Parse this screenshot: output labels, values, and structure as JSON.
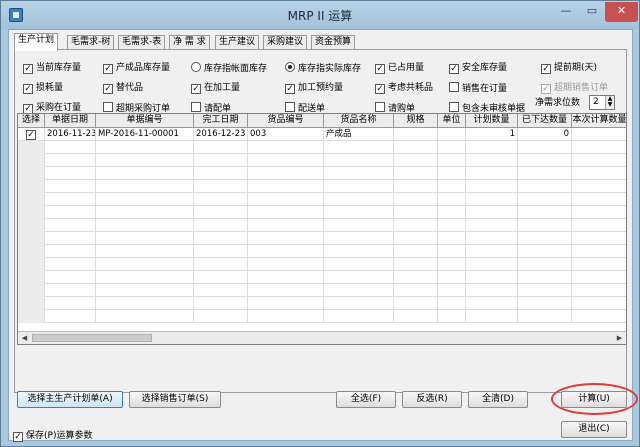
{
  "window": {
    "title": "MRP II 运算",
    "minimize": "—",
    "maximize": "▭",
    "close": "✕"
  },
  "tabs": [
    {
      "label": "生产计划",
      "active": true
    },
    {
      "label": "毛需求-树",
      "active": false
    },
    {
      "label": "毛需求-表",
      "active": false
    },
    {
      "label": "净 需 求",
      "active": false
    },
    {
      "label": "生产建议",
      "active": false
    },
    {
      "label": "采购建议",
      "active": false
    },
    {
      "label": "资金预算",
      "active": false
    }
  ],
  "options": {
    "row1": [
      {
        "label": "当前库存量",
        "type": "checkbox",
        "checked": true
      },
      {
        "label": "产成品库存量",
        "type": "checkbox",
        "checked": true
      },
      {
        "label": "库存指帐面库存",
        "type": "radio",
        "checked": false
      },
      {
        "label": "库存指实际库存",
        "type": "radio",
        "checked": true
      },
      {
        "label": "已占用量",
        "type": "checkbox",
        "checked": true
      },
      {
        "label": "安全库存量",
        "type": "checkbox",
        "checked": true
      },
      {
        "label": "提前期(天)",
        "type": "checkbox",
        "checked": true
      }
    ],
    "row2": [
      {
        "label": "损耗量",
        "type": "checkbox",
        "checked": true
      },
      {
        "label": "替代品",
        "type": "checkbox",
        "checked": true
      },
      {
        "label": "在加工量",
        "type": "checkbox",
        "checked": true
      },
      {
        "label": "加工预约量",
        "type": "checkbox",
        "checked": true
      },
      {
        "label": "考虑共耗品",
        "type": "checkbox",
        "checked": true
      },
      {
        "label": "销售在订量",
        "type": "checkbox",
        "checked": false
      },
      {
        "label": "超期销售订单",
        "type": "checkbox",
        "checked": true,
        "disabled": true
      }
    ],
    "row3": [
      {
        "label": "采购在订量",
        "type": "checkbox",
        "checked": true
      },
      {
        "label": "超期采购订单",
        "type": "checkbox",
        "checked": false
      },
      {
        "label": "请配单",
        "type": "checkbox",
        "checked": false
      },
      {
        "label": "配送单",
        "type": "checkbox",
        "checked": false
      },
      {
        "label": "请购单",
        "type": "checkbox",
        "checked": false
      },
      {
        "label": "包含未审核单据",
        "type": "checkbox",
        "checked": false
      }
    ],
    "precision_label": "净需求位数",
    "precision_value": "2",
    "spin_up": "▲",
    "spin_down": "▼",
    "check_mark": "✓"
  },
  "grid": {
    "columns": [
      "选择",
      "单据日期",
      "单据编号",
      "完工日期",
      "货品编号",
      "货品名称",
      "规格",
      "单位",
      "计划数量",
      "已下达数量",
      "本次计算数量"
    ],
    "rows": [
      {
        "selected": true,
        "doc_date": "2016-11-23",
        "doc_no": "MP-2016-11-00001",
        "finish_date": "2016-12-23",
        "item_no": "003",
        "item_name": "产成品",
        "spec": "",
        "unit": "",
        "plan_qty": "1",
        "issued_qty": "0",
        "calc_qty": ""
      }
    ],
    "scroll_left": "◀",
    "scroll_right": "▶"
  },
  "buttons": {
    "select_mps": "选择主生产计划单(A)",
    "select_sales": "选择销售订单(S)",
    "select_all": "全选(F)",
    "invert": "反选(R)",
    "clear": "全清(D)",
    "calculate": "计算(U)",
    "exit": "退出(C)"
  },
  "footer": {
    "save_params_label": "保存(P)运算参数",
    "save_params_checked": true
  }
}
